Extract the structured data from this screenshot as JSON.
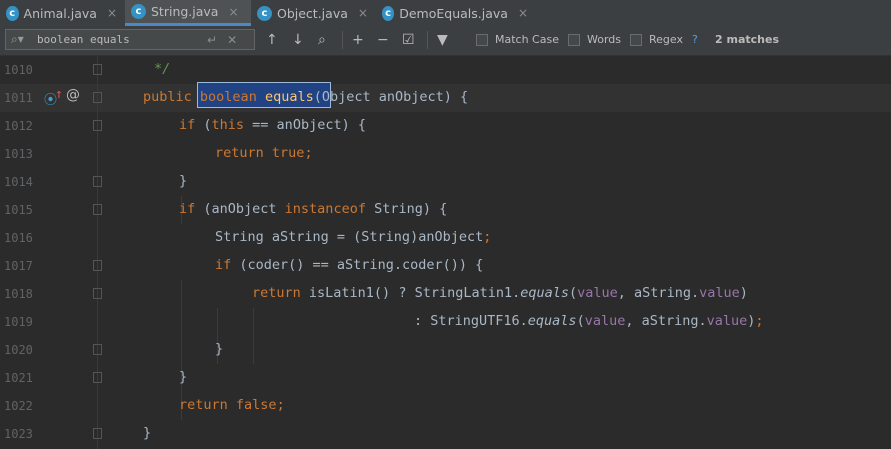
{
  "tabs": [
    {
      "label": "Animal.java",
      "icon": "c-class-icon",
      "active": false
    },
    {
      "label": "String.java",
      "icon": "c-class-icon",
      "active": true
    },
    {
      "label": "Object.java",
      "icon": "c-class-icon",
      "active": false
    },
    {
      "label": "DemoEquals.java",
      "icon": "c-class-icon",
      "active": false
    }
  ],
  "tab_close_glyph": "×",
  "tab_icon_letter": "c",
  "search": {
    "value": "boolean equals"
  },
  "options": {
    "match_case": "Match Case",
    "words": "Words",
    "regex": "Regex",
    "help": "?"
  },
  "matches": "2 matches",
  "colors": {
    "keyword": "#cc7832",
    "method": "#ffc66d",
    "field": "#9876aa",
    "comment": "#629755",
    "match_bg": "#214283"
  },
  "line_numbers": [
    "1010",
    "1011",
    "1012",
    "1013",
    "1014",
    "1015",
    "1016",
    "1017",
    "1018",
    "1019",
    "1020",
    "1021",
    "1022",
    "1023"
  ],
  "code": {
    "l1010": "*/",
    "l1011": {
      "a": "public",
      "b": "boolean",
      "c": "equals",
      "d": "(Object anObject) {"
    },
    "l1012": {
      "a": "if",
      "b": " (",
      "c": "this",
      "d": " == anObject) {"
    },
    "l1013": {
      "a": "return",
      "b": " ",
      "c": "true",
      "d": ";"
    },
    "l1014": "}",
    "l1015": {
      "a": "if",
      "b": " (anObject ",
      "c": "instanceof",
      "d": " String) {"
    },
    "l1016": {
      "a": "String aString = (String)anObject",
      "b": ";"
    },
    "l1017": {
      "a": "if",
      "b": " (coder() == aString.coder()) {"
    },
    "l1018": {
      "a": "return",
      "b": " isLatin1() ? StringLatin1.",
      "c": "equals",
      "d": "(",
      "e": "value",
      "f": ", aString.",
      "g": "value",
      "h": ")"
    },
    "l1019": {
      "a": ": StringUTF16.",
      "b": "equals",
      "c": "(",
      "d": "value",
      "e": ", aString.",
      "f": "value",
      "g": ")",
      "h": ";"
    },
    "l1020": "}",
    "l1021": "}",
    "l1022": {
      "a": "return",
      "b": " ",
      "c": "false",
      "d": ";"
    },
    "l1023": "}"
  }
}
